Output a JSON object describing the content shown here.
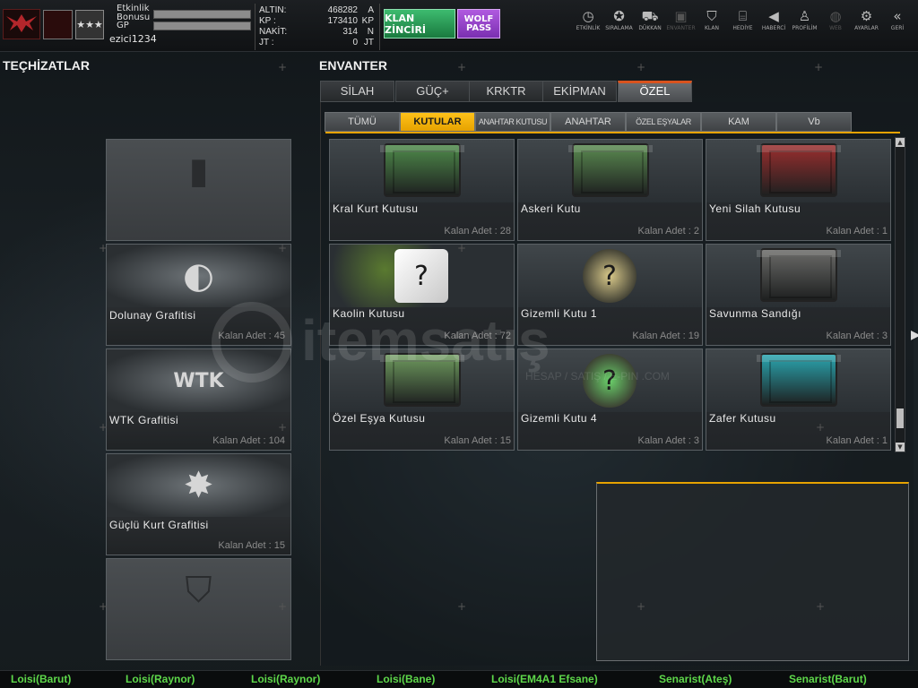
{
  "topbar": {
    "player": {
      "event_bonus_label": "Etkinlik\nBonusu",
      "gp_label": "GP",
      "username": "ezici1234"
    },
    "currencies": [
      {
        "key": "ALTIN:",
        "value": "468282",
        "unit": "A"
      },
      {
        "key": "KP :",
        "value": "173410",
        "unit": "KP"
      },
      {
        "key": "NAKİT:",
        "value": "314",
        "unit": "N"
      },
      {
        "key": "JT :",
        "value": "0",
        "unit": "JT"
      }
    ],
    "klan_button": "KLAN ZİNCİRİ",
    "wolf_pass_button": "WOLF\nPASS",
    "nav": [
      {
        "label": "ETKİNLİK",
        "icon": "clock-icon",
        "glyph": "◷",
        "dim": false
      },
      {
        "label": "SIRALAMA",
        "icon": "medal-icon",
        "glyph": "✪",
        "dim": false
      },
      {
        "label": "DÜKKAN",
        "icon": "cart-icon",
        "glyph": "⛟",
        "dim": false
      },
      {
        "label": "ENVANTER",
        "icon": "inventory-icon",
        "glyph": "▣",
        "dim": true
      },
      {
        "label": "KLAN",
        "icon": "shield-icon",
        "glyph": "⛉",
        "dim": false
      },
      {
        "label": "HEDİYE",
        "icon": "gift-icon",
        "glyph": "⌸",
        "dim": false
      },
      {
        "label": "HABERCİ",
        "icon": "megaphone-icon",
        "glyph": "◀",
        "dim": false
      },
      {
        "label": "PROFİLİM",
        "icon": "profile-icon",
        "glyph": "♙",
        "dim": false
      },
      {
        "label": "WEB",
        "icon": "globe-icon",
        "glyph": "◍",
        "dim": true
      },
      {
        "label": "AYARLAR",
        "icon": "gear-icon",
        "glyph": "⚙",
        "dim": false
      },
      {
        "label": "GERİ",
        "icon": "back-icon",
        "glyph": "«",
        "dim": false
      }
    ]
  },
  "equipment": {
    "title": "TEÇHİZATLAR",
    "slots": [
      {
        "name": "",
        "qty": "",
        "icon": "spray-can-icon",
        "glyph": "▮",
        "empty": true
      },
      {
        "name": "Dolunay Grafitisi",
        "qty": "Kalan Adet : 45",
        "icon": "full-moon-graffiti-icon",
        "glyph": "◐",
        "empty": false
      },
      {
        "name": "WTK Grafitisi",
        "qty": "Kalan Adet : 104",
        "icon": "wolf-graffiti-icon",
        "glyph": "WTK",
        "empty": false
      },
      {
        "name": "Güçlü Kurt Grafitisi",
        "qty": "Kalan Adet : 15",
        "icon": "wolf-beast-graffiti-icon",
        "glyph": "✸",
        "empty": false
      },
      {
        "name": "",
        "qty": "",
        "icon": "shield-placeholder-icon",
        "glyph": "⛉",
        "empty": true
      }
    ]
  },
  "inventory": {
    "title": "ENVANTER",
    "main_tabs": [
      "SİLAH",
      "GÜÇ+",
      "KRKTR",
      "EKİPMAN",
      "ÖZEL"
    ],
    "active_main_tab": 4,
    "sub_tabs": [
      "TÜMÜ",
      "KUTULAR",
      "ANAHTAR KUTUSU",
      "ANAHTAR",
      "ÖZEL EŞYALAR",
      "KAM",
      "Vb"
    ],
    "active_sub_tab": 1,
    "items": [
      {
        "name": "Kral Kurt Kutusu",
        "qty": "Kalan Adet : 28",
        "kind": "crate",
        "color": "#4e8a4a"
      },
      {
        "name": "Askeri Kutu",
        "qty": "Kalan Adet : 2",
        "kind": "crate",
        "color": "#5a8a50"
      },
      {
        "name": "Yeni Silah Kutusu",
        "qty": "Kalan Adet : 1",
        "kind": "crate",
        "color": "#9a2e2e"
      },
      {
        "name": "Kaolin Kutusu",
        "qty": "Kalan Adet : 72",
        "kind": "cube",
        "color": "#c8c8c8"
      },
      {
        "name": "Gizemli Kutu 1",
        "qty": "Kalan Adet : 19",
        "kind": "mystery",
        "color": "#d9c98a"
      },
      {
        "name": "Savunma Sandığı",
        "qty": "Kalan Adet : 3",
        "kind": "chest",
        "color": "#6a6a68"
      },
      {
        "name": "Özel Eşya Kutusu",
        "qty": "Kalan Adet : 15",
        "kind": "crate",
        "color": "#6e9a5e"
      },
      {
        "name": "Gizemli Kutu 4",
        "qty": "Kalan Adet : 3",
        "kind": "mystery",
        "color": "#6ad06a"
      },
      {
        "name": "Zafer Kutusu",
        "qty": "Kalan Adet : 1",
        "kind": "crate",
        "color": "#2aa6b0"
      }
    ]
  },
  "bottom_ticker": [
    "Loisi(Barut)",
    "Loisi(Raynor)",
    "Loisi(Raynor)",
    "Loisi(Bane)",
    "Loisi(EM4A1 Efsane)",
    "Senarist(Ateş)",
    "Senarist(Barut)"
  ],
  "watermark": {
    "brand": "itemsatış",
    "tagline": "HESAP / SATIŞ / E-PIN .COM"
  },
  "colors": {
    "accent": "#e6a200",
    "active_tab_line": "#d9531e",
    "ticker": "#5ed84a"
  }
}
